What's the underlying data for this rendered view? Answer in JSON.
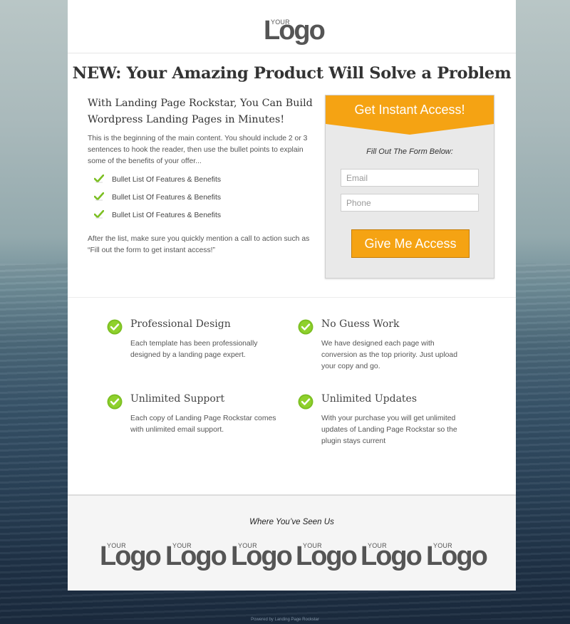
{
  "header": {
    "logo_small": "YOUR",
    "logo_word": "Logo"
  },
  "headline": "NEW: Your Amazing Product Will Solve a Problem",
  "subheadline": "With Landing Page Rockstar, You Can Build Wordpress Landing Pages in Minutes!",
  "intro": "This is the beginning of the main content. You should include 2 or 3 sentences to hook the reader, then use the bullet points to explain some of the benefits of your offer...",
  "bullets": [
    "Bullet List Of Features & Benefits",
    "Bullet List Of Features & Benefits",
    "Bullet List Of Features & Benefits"
  ],
  "outro": "After the list, make sure you quickly mention a call to action such as “Fill out the form to get instant access!”",
  "form": {
    "heading": "Get Instant Access!",
    "label": "Fill Out The Form Below:",
    "email_placeholder": "Email",
    "phone_placeholder": "Phone",
    "submit": "Give Me Access"
  },
  "features": [
    {
      "title": "Professional Design",
      "text": "Each template has been professionally designed by a landing page expert."
    },
    {
      "title": "No Guess Work",
      "text": "We have designed each page with conversion as the top priority. Just upload your copy and go."
    },
    {
      "title": "Unlimited Support",
      "text": "Each copy of Landing Page Rockstar comes with unlimited email support."
    },
    {
      "title": "Unlimited Updates",
      "text": "With your purchase you will get unlimited updates of Landing Page Rockstar so the plugin stays current"
    }
  ],
  "seen": {
    "title": "Where You’ve Seen Us",
    "logos": [
      {
        "small": "YOUR",
        "word": "Logo"
      },
      {
        "small": "YOUR",
        "word": "Logo"
      },
      {
        "small": "YOUR",
        "word": "Logo"
      },
      {
        "small": "YOUR",
        "word": "Logo"
      },
      {
        "small": "YOUR",
        "word": "Logo"
      },
      {
        "small": "YOUR",
        "word": "Logo"
      }
    ]
  },
  "footer": {
    "powered": "Powered by Landing Page Rockstar"
  },
  "colors": {
    "accent": "#f5a313",
    "check_green": "#7cbf22"
  }
}
